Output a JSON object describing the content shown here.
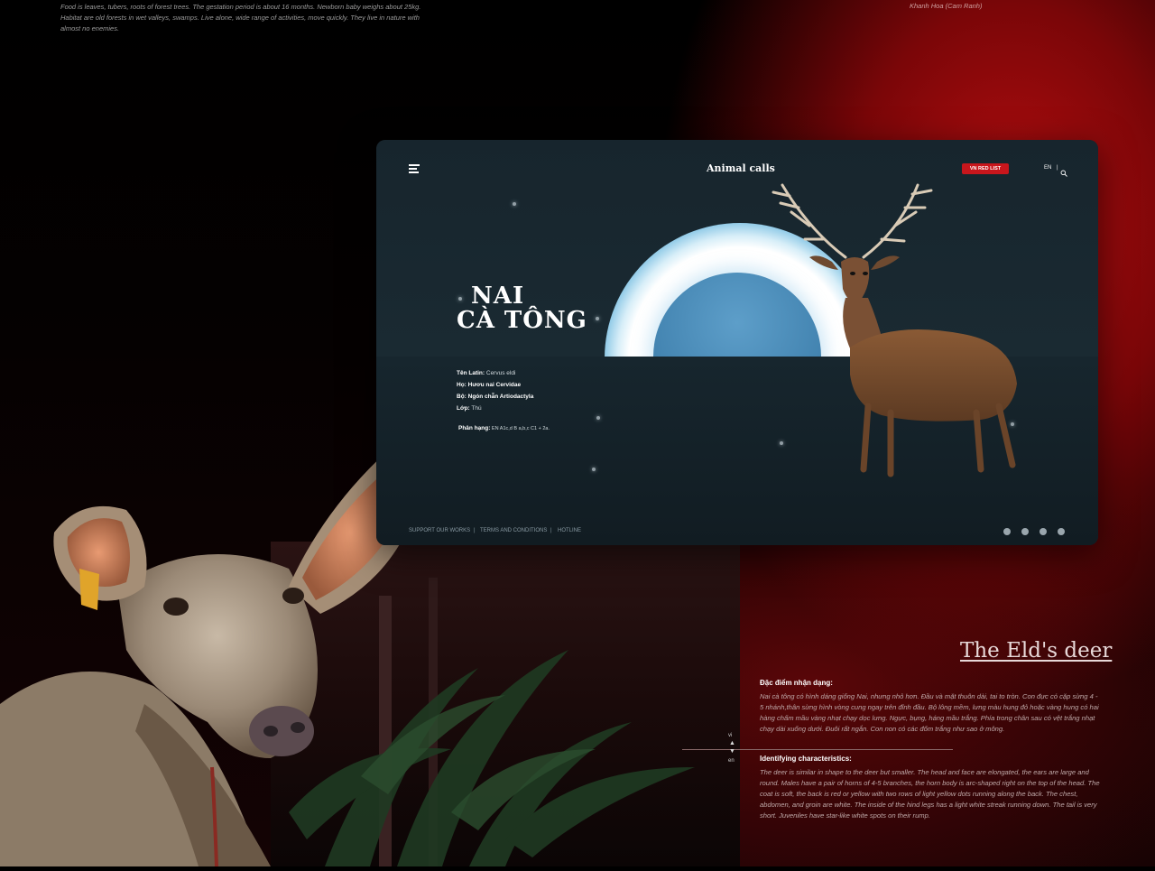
{
  "top_left_text": "Food is leaves, tubers, roots of forest trees. The gestation period is about 16 months. Newborn baby weighs about 25kg. Habitat are old forests in wet valleys, swamps. Live alone, wide range of activities, move quickly. They live in nature with almost no enemies.",
  "top_right_location": "Khanh Hoa (Cam Ranh)",
  "card": {
    "brand": "Animal calls",
    "red_list_button": "VN RED LIST",
    "lang": "EN",
    "lang_separator": "|",
    "title_line1": "NAI",
    "title_line2": "CÀ TÔNG",
    "info": [
      {
        "label": "Tên Latin:",
        "value": " Cervus eldi"
      },
      {
        "label": "Họ: Hươu nai Cervidae",
        "value": ""
      },
      {
        "label": "Bộ: Ngón chẵn Artiodactyla",
        "value": ""
      },
      {
        "label": "Lớp:",
        "value": " Thú"
      }
    ],
    "classification_label": "Phân hạng:",
    "classification_value": " EN A1c,d B a,b,c C1 + 2a.",
    "footer_links": [
      "SUPPORT OUR WORKS",
      "TERMS AND CONDITIONS",
      "HOTLINE"
    ],
    "footer_separator": "|",
    "social_icons": [
      "facebook-icon",
      "youtube-icon",
      "instagram-icon",
      "twitter-icon"
    ]
  },
  "description": {
    "title": "The Eld's deer",
    "vi_heading": "Đặc điểm nhận dạng:",
    "vi_text": "Nai cà tông có hình dáng giống Nai, nhưng nhỏ hơn. Đầu và mặt thuôn dài, tai to tròn. Con đực có cặp sừng 4 - 5 nhánh,thân sừng hình vòng cung ngay trên đỉnh đầu. Bộ lông mềm, lưng màu hung đỏ hoặc vàng hung có hai hàng chấm mầu vàng nhạt chạy dọc lưng. Ngực, bụng, háng mầu trắng. Phía trong chân sau có vệt trắng nhạt chạy dài xuống dưới. Đuôi rất ngắn. Con non có các đốm trắng như sao ở mông.",
    "en_heading": "Identifying characteristics:",
    "en_text": "The deer is similar in shape to the deer but smaller. The head and face are elongated, the ears are large and round. Males have a pair of horns of 4-5 branches, the horn body is arc-shaped right on the top of the head. The coat is soft, the back is red or yellow with two rows of light yellow dots running along the back. The chest, abdomen, and groin are white. The inside of the hind legs has a light white streak running down. The tail is very short. Juveniles have star-like white spots on their rump.",
    "lang_vi": "vi",
    "lang_en": "en"
  }
}
